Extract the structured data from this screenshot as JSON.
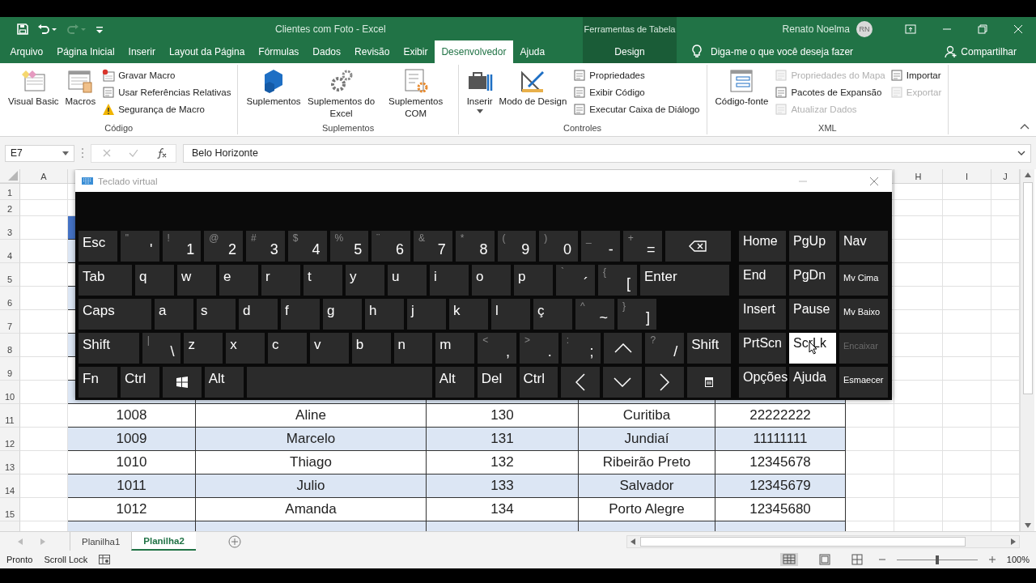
{
  "window": {
    "title": "Clientes com Foto  -  Excel",
    "context_title": "Ferramentas de Tabela",
    "user": "Renato Noelma",
    "initials": "RN"
  },
  "tabs": [
    {
      "label": "Arquivo",
      "selected": false
    },
    {
      "label": "Página Inicial",
      "selected": false
    },
    {
      "label": "Inserir",
      "selected": false
    },
    {
      "label": "Layout da Página",
      "selected": false
    },
    {
      "label": "Fórmulas",
      "selected": false
    },
    {
      "label": "Dados",
      "selected": false
    },
    {
      "label": "Revisão",
      "selected": false
    },
    {
      "label": "Exibir",
      "selected": false
    },
    {
      "label": "Desenvolvedor",
      "selected": true
    },
    {
      "label": "Ajuda",
      "selected": false
    }
  ],
  "context_tab": {
    "label": "Design",
    "selected": false
  },
  "tell_me": "Diga-me o que você deseja fazer",
  "share": "Compartilhar",
  "ribbon": [
    {
      "label": "Código",
      "large": [
        {
          "label": "Visual Basic",
          "kind": "vba"
        },
        {
          "label": "Macros",
          "kind": "macros"
        }
      ],
      "small_columns": [
        [
          {
            "label": "Gravar Macro",
            "kind": "record",
            "disabled": false
          },
          {
            "label": "Usar Referências Relativas",
            "kind": "doc",
            "disabled": false
          },
          {
            "label": "Segurança de Macro",
            "kind": "warning",
            "disabled": false
          }
        ]
      ]
    },
    {
      "label": "Suplementos",
      "large": [
        {
          "label": "Suplementos",
          "kind": "cube"
        },
        {
          "label": "Suplementos do Excel",
          "kind": "gears"
        },
        {
          "label": "Suplementos COM",
          "kind": "com"
        }
      ]
    },
    {
      "label": "Controles",
      "large": [
        {
          "label": "Inserir",
          "kind": "toolbox",
          "caret": true
        },
        {
          "label": "Modo de Design",
          "kind": "design"
        }
      ],
      "small_columns": [
        [
          {
            "label": "Propriedades",
            "kind": "doc",
            "disabled": false
          },
          {
            "label": "Exibir Código",
            "kind": "doc",
            "disabled": false
          },
          {
            "label": "Executar Caixa de Diálogo",
            "kind": "doc",
            "disabled": false
          }
        ]
      ]
    },
    {
      "label": "XML",
      "large": [
        {
          "label": "Código-fonte",
          "kind": "source"
        }
      ],
      "small_columns": [
        [
          {
            "label": "Propriedades do Mapa",
            "kind": "doc",
            "disabled": true
          },
          {
            "label": "Pacotes de Expansão",
            "kind": "doc",
            "disabled": false
          },
          {
            "label": "Atualizar Dados",
            "kind": "doc",
            "disabled": true
          }
        ],
        [
          {
            "label": "Importar",
            "kind": "doc",
            "disabled": false
          },
          {
            "label": "Exportar",
            "kind": "doc",
            "disabled": true
          }
        ]
      ]
    }
  ],
  "formula_bar": {
    "cell": "E7",
    "value": "Belo Horizonte"
  },
  "column_headers": [
    "A",
    "H",
    "I",
    "J"
  ],
  "row_numbers": [
    "1",
    "2",
    "3",
    "4",
    "5",
    "6",
    "7",
    "8",
    "9",
    "10",
    "11",
    "12",
    "13",
    "14",
    "15"
  ],
  "table_rows": [
    {
      "shaded": false,
      "cells": [
        "1008",
        "Aline",
        "130",
        "Curitiba",
        "22222222"
      ]
    },
    {
      "shaded": true,
      "cells": [
        "1009",
        "Marcelo",
        "131",
        "Jundiaí",
        "11111111"
      ]
    },
    {
      "shaded": false,
      "cells": [
        "1010",
        "Thiago",
        "132",
        "Ribeirão Preto",
        "12345678"
      ]
    },
    {
      "shaded": true,
      "cells": [
        "1011",
        "Julio",
        "133",
        "Salvador",
        "12345679"
      ]
    },
    {
      "shaded": false,
      "cells": [
        "1012",
        "Amanda",
        "134",
        "Porto Alegre",
        "12345680"
      ]
    }
  ],
  "keyboard": {
    "title": "Teclado virtual",
    "rows": [
      [
        {
          "kind": "key",
          "label": "Esc"
        },
        {
          "kind": "key",
          "shift": "\"",
          "label": "'"
        },
        {
          "kind": "key",
          "shift": "!",
          "label": "1"
        },
        {
          "kind": "key",
          "shift": "@",
          "label": "2"
        },
        {
          "kind": "key",
          "shift": "#",
          "label": "3"
        },
        {
          "kind": "key",
          "shift": "$",
          "label": "4"
        },
        {
          "kind": "key",
          "shift": "%",
          "label": "5"
        },
        {
          "kind": "key",
          "shift": "¨",
          "label": "6"
        },
        {
          "kind": "key",
          "shift": "&",
          "label": "7"
        },
        {
          "kind": "key",
          "shift": "*",
          "label": "8"
        },
        {
          "kind": "key",
          "shift": "(",
          "label": "9"
        },
        {
          "kind": "key",
          "shift": ")",
          "label": "0"
        },
        {
          "kind": "key",
          "shift": "_",
          "label": "-"
        },
        {
          "kind": "key",
          "shift": "+",
          "label": "="
        },
        {
          "kind": "backspace"
        }
      ],
      [
        {
          "kind": "key",
          "label": "Tab"
        },
        {
          "kind": "key",
          "label": "q"
        },
        {
          "kind": "key",
          "label": "w"
        },
        {
          "kind": "key",
          "label": "e"
        },
        {
          "kind": "key",
          "label": "r"
        },
        {
          "kind": "key",
          "label": "t"
        },
        {
          "kind": "key",
          "label": "y"
        },
        {
          "kind": "key",
          "label": "u"
        },
        {
          "kind": "key",
          "label": "i"
        },
        {
          "kind": "key",
          "label": "o"
        },
        {
          "kind": "key",
          "label": "p"
        },
        {
          "kind": "key",
          "shift": "`",
          "label": "´"
        },
        {
          "kind": "key",
          "shift": "{",
          "label": "["
        },
        {
          "kind": "key",
          "label": "Enter"
        }
      ],
      [
        {
          "kind": "key",
          "label": "Caps"
        },
        {
          "kind": "key",
          "label": "a"
        },
        {
          "kind": "key",
          "label": "s"
        },
        {
          "kind": "key",
          "label": "d"
        },
        {
          "kind": "key",
          "label": "f"
        },
        {
          "kind": "key",
          "label": "g"
        },
        {
          "kind": "key",
          "label": "h"
        },
        {
          "kind": "key",
          "label": "j"
        },
        {
          "kind": "key",
          "label": "k"
        },
        {
          "kind": "key",
          "label": "l"
        },
        {
          "kind": "key",
          "label": "ç"
        },
        {
          "kind": "key",
          "shift": "^",
          "label": "~"
        },
        {
          "kind": "key",
          "shift": "}",
          "label": "]"
        }
      ],
      [
        {
          "kind": "key",
          "label": "Shift"
        },
        {
          "kind": "key",
          "shift": "|",
          "label": "\\"
        },
        {
          "kind": "key",
          "label": "z"
        },
        {
          "kind": "key",
          "label": "x"
        },
        {
          "kind": "key",
          "label": "c"
        },
        {
          "kind": "key",
          "label": "v"
        },
        {
          "kind": "key",
          "label": "b"
        },
        {
          "kind": "key",
          "label": "n"
        },
        {
          "kind": "key",
          "label": "m"
        },
        {
          "kind": "key",
          "shift": "<",
          "label": ","
        },
        {
          "kind": "key",
          "shift": ">",
          "label": "."
        },
        {
          "kind": "key",
          "shift": ":",
          "label": ";"
        },
        {
          "kind": "up"
        },
        {
          "kind": "key",
          "shift": "?",
          "label": "/"
        },
        {
          "kind": "key",
          "label": "Shift"
        }
      ],
      [
        {
          "kind": "key",
          "label": "Fn"
        },
        {
          "kind": "key",
          "label": "Ctrl"
        },
        {
          "kind": "windows"
        },
        {
          "kind": "key",
          "label": "Alt"
        },
        {
          "kind": "space"
        },
        {
          "kind": "key",
          "label": "Alt"
        },
        {
          "kind": "key",
          "label": "Del"
        },
        {
          "kind": "key",
          "label": "Ctrl"
        },
        {
          "kind": "left"
        },
        {
          "kind": "down"
        },
        {
          "kind": "right"
        },
        {
          "kind": "menu"
        }
      ]
    ],
    "nav_keys": [
      {
        "label": "Home",
        "on": false,
        "disabled": false
      },
      {
        "label": "PgUp",
        "on": false,
        "disabled": false
      },
      {
        "label": "Nav",
        "on": false,
        "disabled": false
      },
      {
        "label": "End",
        "on": false,
        "disabled": false
      },
      {
        "label": "PgDn",
        "on": false,
        "disabled": false
      },
      {
        "label": "Mv Cima",
        "on": false,
        "disabled": false
      },
      {
        "label": "Insert",
        "on": false,
        "disabled": false
      },
      {
        "label": "Pause",
        "on": false,
        "disabled": false
      },
      {
        "label": "Mv Baixo",
        "on": false,
        "disabled": false
      },
      {
        "label": "PrtScn",
        "on": false,
        "disabled": false
      },
      {
        "label": "ScrLk",
        "on": true,
        "disabled": false
      },
      {
        "label": "Encaixar",
        "on": false,
        "disabled": true
      },
      {
        "label": "Opções",
        "on": false,
        "disabled": false
      },
      {
        "label": "Ajuda",
        "on": false,
        "disabled": false
      },
      {
        "label": "Esmaecer",
        "on": false,
        "disabled": false
      }
    ]
  },
  "sheet_tabs": [
    {
      "label": "Planilha1",
      "selected": false
    },
    {
      "label": "Planilha2",
      "selected": true
    }
  ],
  "status_bar": {
    "ready": "Pronto",
    "scroll_lock": "Scroll Lock",
    "zoom": "100%",
    "zoom_slider": {
      "level": 0.5
    }
  }
}
